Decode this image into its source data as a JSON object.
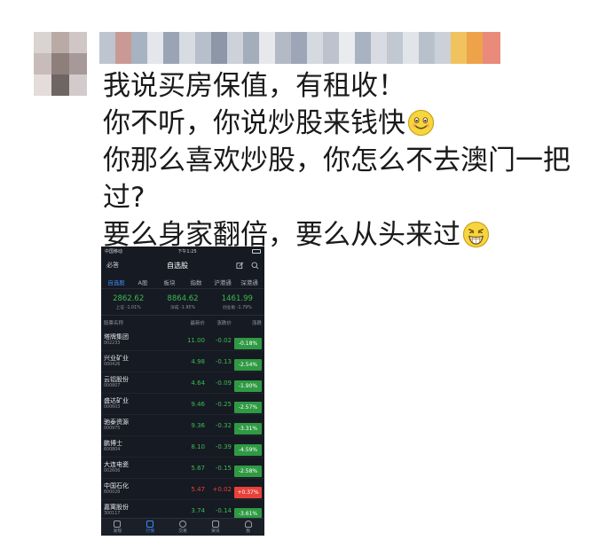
{
  "post": {
    "lines": [
      "我说买房保值，有租收！",
      "你不听，你说炒股来钱快",
      "你那么喜欢炒股，你怎么不去澳门一把",
      "过?",
      "要么身家翻倍，要么从头来过"
    ]
  },
  "screenshot": {
    "status_bar": {
      "carrier": "中国移动",
      "time": "下午1:25"
    },
    "header": {
      "left": "必答",
      "title": "自选股",
      "edit_icon": "edit-icon",
      "search_icon": "search-icon"
    },
    "tabs": [
      "自选股",
      "A股",
      "板块",
      "指数",
      "沪港通",
      "深港通"
    ],
    "indices": [
      {
        "value": "2862.62",
        "sub": "上证 -1.01%"
      },
      {
        "value": "8864.62",
        "sub": "深成 -1.95%"
      },
      {
        "value": "1461.99",
        "sub": "创业板 -1.79%"
      }
    ],
    "columns": {
      "name": "股票名称",
      "price": "最新价",
      "change": "涨跌价",
      "percent": "涨跌"
    },
    "stocks": [
      {
        "name": "塔牌集团",
        "code": "002233",
        "price": "11.00",
        "change": "-0.02",
        "percent": "-0.18%"
      },
      {
        "name": "兴业矿业",
        "code": "000426",
        "price": "4.98",
        "change": "-0.13",
        "percent": "-2.54%"
      },
      {
        "name": "云铝股份",
        "code": "000807",
        "price": "4.64",
        "change": "-0.09",
        "percent": "-1.90%"
      },
      {
        "name": "盛达矿业",
        "code": "000603",
        "price": "9.46",
        "change": "-0.25",
        "percent": "-2.57%"
      },
      {
        "name": "驰泰资源",
        "code": "000975",
        "price": "9.36",
        "change": "-0.32",
        "percent": "-3.31%"
      },
      {
        "name": "鹏博士",
        "code": "600804",
        "price": "8.10",
        "change": "-0.39",
        "percent": "-4.59%"
      },
      {
        "name": "大连电瓷",
        "code": "002606",
        "price": "5.67",
        "change": "-0.15",
        "percent": "-2.58%"
      },
      {
        "name": "中国石化",
        "code": "600028",
        "price": "5.47",
        "change": "+0.02",
        "percent": "+0.37%"
      },
      {
        "name": "嘉寓股份",
        "code": "300117",
        "price": "3.74",
        "change": "-0.14",
        "percent": "-3.61%"
      }
    ],
    "bottom_nav": [
      "发现",
      "行情",
      "交易",
      "资讯",
      "我"
    ],
    "colors": {
      "down": "#3cba54",
      "up": "#e8413a",
      "accent": "#3d8bff",
      "background": "#161a22"
    }
  }
}
